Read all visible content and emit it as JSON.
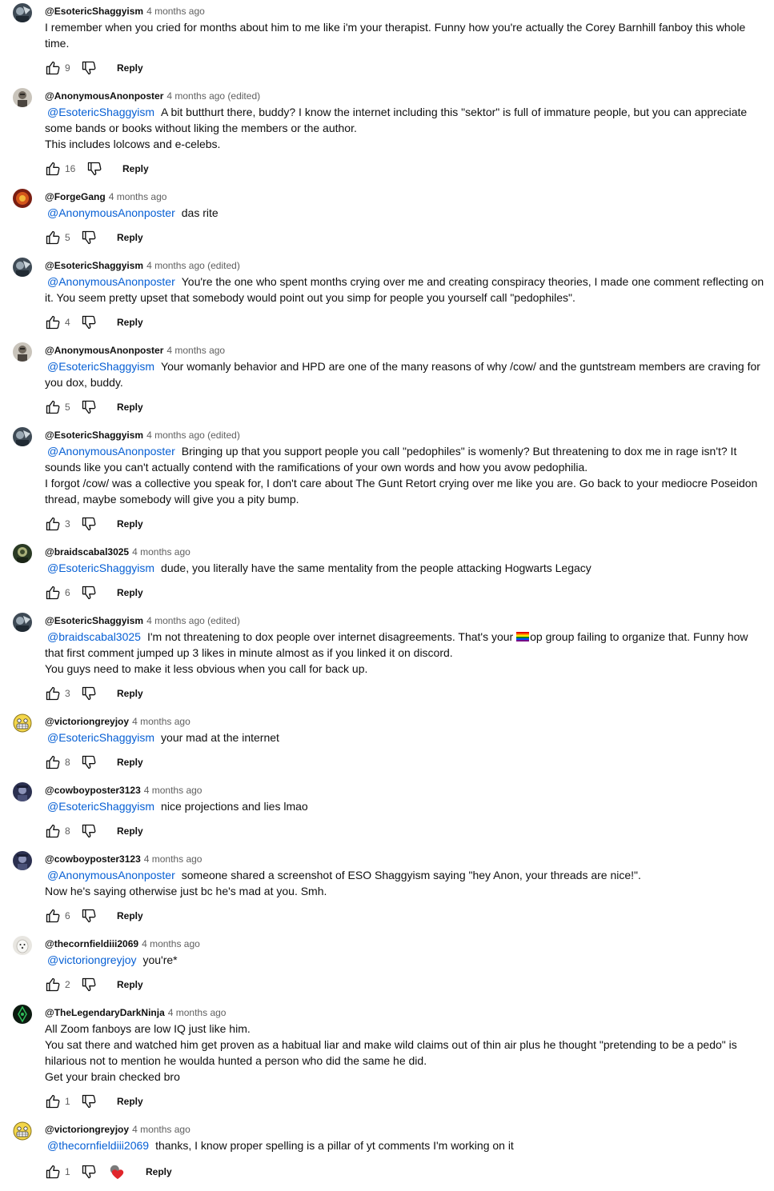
{
  "reply_label": "Reply",
  "colors": {
    "mention": "#065fd4",
    "meta": "#606060",
    "text": "#0f0f0f",
    "heart": "#e0252b"
  },
  "icons": {
    "like": "thumbs-up-icon",
    "dislike": "thumbs-down-icon",
    "creator_heart": "creator-heart-icon"
  },
  "comments": [
    {
      "author": "@EsotericShaggyism",
      "time": "4 months ago",
      "mention": "",
      "lines": [
        "I remember when you cried for months about him to me like i'm your therapist. Funny how you're actually the Corey Barnhill fanboy this whole time."
      ],
      "likes": "9"
    },
    {
      "author": "@AnonymousAnonposter",
      "time": "4 months ago (edited)",
      "mention": "@EsotericShaggyism",
      "lines": [
        "A bit butthurt there, buddy? I know the internet including this \"sektor\" is full of immature people, but you can appreciate some bands or books without liking the members or the author.",
        "This includes lolcows and e-celebs."
      ],
      "likes": "16"
    },
    {
      "author": "@ForgeGang",
      "time": "4 months ago",
      "mention": "@AnonymousAnonposter",
      "lines": [
        "das rite"
      ],
      "likes": "5"
    },
    {
      "author": "@EsotericShaggyism",
      "time": "4 months ago (edited)",
      "mention": "@AnonymousAnonposter",
      "lines": [
        "You're the one who spent months crying over me and creating conspiracy theories, I made one comment reflecting on it. You seem pretty upset that somebody would point out you simp for people you yourself call \"pedophiles\"."
      ],
      "likes": "4"
    },
    {
      "author": "@AnonymousAnonposter",
      "time": "4 months ago",
      "mention": "@EsotericShaggyism",
      "lines": [
        "Your womanly behavior and HPD are one of the many reasons of why /cow/ and the guntstream members are craving for you dox, buddy."
      ],
      "likes": "5"
    },
    {
      "author": "@EsotericShaggyism",
      "time": "4 months ago (edited)",
      "mention": "@AnonymousAnonposter",
      "lines": [
        "Bringing up that you support people you call \"pedophiles\" is womenly? But threatening to dox me in rage isn't? It sounds like you can't actually contend with the ramifications of your own words and how you avow pedophilia.",
        "I forgot /cow/ was a collective you speak for, I don't care about The Gunt Retort crying over me like you are. Go back to your mediocre Poseidon thread, maybe somebody will give you a pity bump."
      ],
      "likes": "3"
    },
    {
      "author": "@braidscabal3025",
      "time": "4 months ago",
      "mention": "@EsotericShaggyism",
      "lines": [
        "dude, you literally have the same mentality from the people attacking Hogwarts Legacy"
      ],
      "likes": "6"
    },
    {
      "author": "@EsotericShaggyism",
      "time": "4 months ago (edited)",
      "mention": "@braidscabal3025",
      "lines_pre": "I'm not threatening to dox people over internet disagreements. That's your ",
      "lines_post": "op group failing to organize that. Funny how that first comment jumped up 3 likes in minute almost as if you linked it on discord.",
      "lines": [
        "You guys need to make it less obvious when you call for back up."
      ],
      "likes": "3"
    },
    {
      "author": "@victoriongreyjoy",
      "time": "4 months ago",
      "mention": "@EsotericShaggyism",
      "lines": [
        "your mad at the internet"
      ],
      "likes": "8"
    },
    {
      "author": "@cowboyposter3123",
      "time": "4 months ago",
      "mention": "@EsotericShaggyism",
      "lines": [
        "nice projections and lies lmao"
      ],
      "likes": "8"
    },
    {
      "author": "@cowboyposter3123",
      "time": "4 months ago",
      "mention": "@AnonymousAnonposter",
      "lines": [
        "someone shared a screenshot of ESO Shaggyism saying \"hey Anon, your threads are nice!\".",
        "Now he's saying otherwise just bc he's mad at you. Smh."
      ],
      "likes": "6"
    },
    {
      "author": "@thecornfieldiii2069",
      "time": "4 months ago",
      "mention": "@victoriongreyjoy",
      "lines": [
        "you're*"
      ],
      "likes": "2"
    },
    {
      "author": "@TheLegendaryDarkNinja",
      "time": "4 months ago",
      "mention": "",
      "lines": [
        "All Zoom fanboys are low IQ just like him.",
        "You sat there and watched him get proven as a habitual liar and make wild claims out of thin air plus he thought \"pretending to be a pedo\" is hilarious not to mention he woulda hunted a person who did the same he did.",
        "Get your brain checked bro"
      ],
      "likes": "1"
    },
    {
      "author": "@victoriongreyjoy",
      "time": "4 months ago",
      "mention": "@thecornfieldiii2069",
      "lines": [
        "thanks, I know proper spelling is a pillar of yt comments I'm working on it"
      ],
      "likes": "1",
      "creator_heart": true
    }
  ]
}
